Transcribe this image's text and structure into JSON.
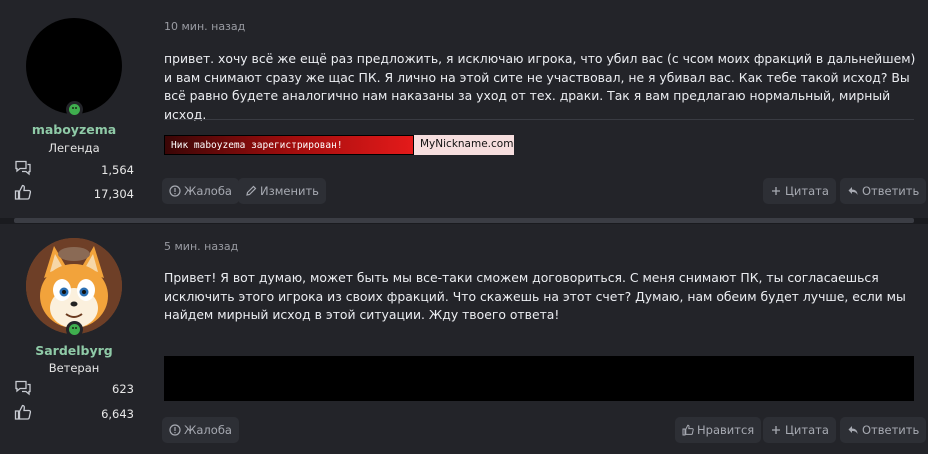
{
  "posts": [
    {
      "author": "maboyzema",
      "user_title": "Легенда",
      "messages_count": "1,564",
      "reactions_count": "17,304",
      "date": "10 мин. назад",
      "body": "привет. хочу всё же ещё раз предложить, я исключаю игрока, что убил вас (с чсом моих фракций в дальнейшем) и вам снимают сразу же щас ПК. Я лично на этой сите не участвовал, не я убивал вас. Как тебе такой исход? Вы всё равно будете аналогично нам наказаны за уход от тех. драки. Так я вам предлагаю нормальный, мирный исход.",
      "signature_left": "Ник maboyzema зарегистрирован!",
      "signature_right": "MyNickname.com",
      "actions": {
        "report": "Жалоба",
        "edit": "Изменить",
        "quote": "Цитата",
        "reply": "Ответить"
      }
    },
    {
      "author": "Sardelbyrg",
      "user_title": "Ветеран",
      "messages_count": "623",
      "reactions_count": "6,643",
      "date": "5 мин. назад",
      "body": "Привет! Я вот думаю, может быть мы все-таки сможем договориться. С меня снимают ПК, ты согласаешься исключить этого игрока из своих фракций. Что скажешь на этот счет? Думаю, нам обеим будет лучше, если мы найдем мирный исход в этой ситуации. Жду твоего ответа!",
      "actions": {
        "report": "Жалоба",
        "like": "Нравится",
        "quote": "Цитата",
        "reply": "Ответить"
      }
    }
  ],
  "colors": {
    "username": "#8fcaa7",
    "online": "#3fae4e",
    "background": "#232429",
    "button": "#2d2f35"
  },
  "icons": [
    "online-indicator-icon",
    "messages-icon",
    "reactions-icon",
    "report-icon",
    "edit-icon",
    "like-icon",
    "quote-plus-icon",
    "reply-icon"
  ]
}
